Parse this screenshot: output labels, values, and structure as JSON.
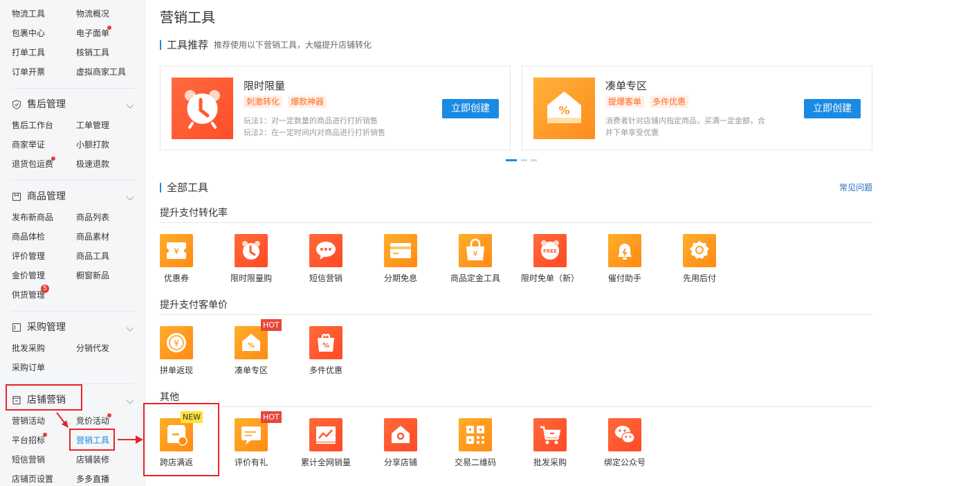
{
  "sidebar": {
    "logistics": [
      "物流工具",
      "物流概况",
      "包裹中心",
      "电子面单",
      "打单工具",
      "核销工具",
      "订单开票",
      "虚拟商家工具"
    ],
    "aftersale": {
      "title": "售后管理",
      "items": [
        "售后工作台",
        "工单管理",
        "商家举证",
        "小额打款",
        "退货包运费",
        "极速退款"
      ]
    },
    "goods": {
      "title": "商品管理",
      "items": [
        "发布新商品",
        "商品列表",
        "商品体检",
        "商品素材",
        "评价管理",
        "商品工具",
        "金价管理",
        "橱窗新品",
        "供货管理"
      ],
      "badge": "5"
    },
    "purchase": {
      "title": "采购管理",
      "items": [
        "批发采购",
        "分销代发",
        "采购订单"
      ]
    },
    "shop": {
      "title": "店铺营销",
      "items": [
        "营销活动",
        "竞价活动",
        "平台招标",
        "营销工具",
        "短信营销",
        "店铺装修",
        "店铺页设置",
        "多多直播"
      ]
    }
  },
  "main": {
    "title": "营销工具",
    "recommend": {
      "title": "工具推荐",
      "subtitle": "推荐使用以下营销工具，大幅提升店铺转化",
      "cards": [
        {
          "name": "限时限量",
          "tags": [
            "刺激转化",
            "爆款神器"
          ],
          "desc": "玩法1：对一定数量的商品进行打折销售\n玩法2：在一定时间内对商品进行打折销售",
          "button": "立即创建",
          "icon": "alarm-clock-icon"
        },
        {
          "name": "凑单专区",
          "tags": [
            "提爆客单",
            "多件优惠"
          ],
          "desc": "消费者针对店铺内指定商品，买满一定金额，合\n并下单享受优惠",
          "button": "立即创建",
          "icon": "discount-house-icon"
        }
      ]
    },
    "all_tools": {
      "title": "全部工具",
      "faq": "常见问题",
      "groups": [
        {
          "title": "提升支付转化率",
          "tools": [
            {
              "label": "优惠券",
              "icon": "coupon-icon"
            },
            {
              "label": "限时限量购",
              "icon": "alarm-clock-icon"
            },
            {
              "label": "短信营销",
              "icon": "chat-bubble-icon"
            },
            {
              "label": "分期免息",
              "icon": "credit-card-icon"
            },
            {
              "label": "商品定金工具",
              "icon": "deposit-bag-icon"
            },
            {
              "label": "限时免单（新）",
              "icon": "free-clock-icon",
              "glyph": "FREE"
            },
            {
              "label": "催付助手",
              "icon": "bell-icon"
            },
            {
              "label": "先用后付",
              "icon": "badge-icon"
            }
          ]
        },
        {
          "title": "提升支付客单价",
          "tools": [
            {
              "label": "拼单返现",
              "icon": "cashback-icon"
            },
            {
              "label": "凑单专区",
              "icon": "discount-house-icon",
              "ribbon": "HOT"
            },
            {
              "label": "多件优惠",
              "icon": "gift-bag-icon"
            }
          ]
        },
        {
          "title": "其他",
          "tools": [
            {
              "label": "跨店满返",
              "icon": "store-icon",
              "ribbon": "NEW"
            },
            {
              "label": "评价有礼",
              "icon": "comment-icon",
              "ribbon": "HOT"
            },
            {
              "label": "累计全网销量",
              "icon": "trend-chart-icon"
            },
            {
              "label": "分享店铺",
              "icon": "share-shop-icon"
            },
            {
              "label": "交易二维码",
              "icon": "qrcode-icon"
            },
            {
              "label": "批发采购",
              "icon": "cart-icon"
            },
            {
              "label": "绑定公众号",
              "icon": "wechat-icon"
            }
          ]
        }
      ]
    }
  },
  "colors": {
    "accent": "#1a8ae2",
    "annotation": "#e8232a",
    "tool_orange": "#ff8a14",
    "tool_red": "#ff4a25"
  }
}
